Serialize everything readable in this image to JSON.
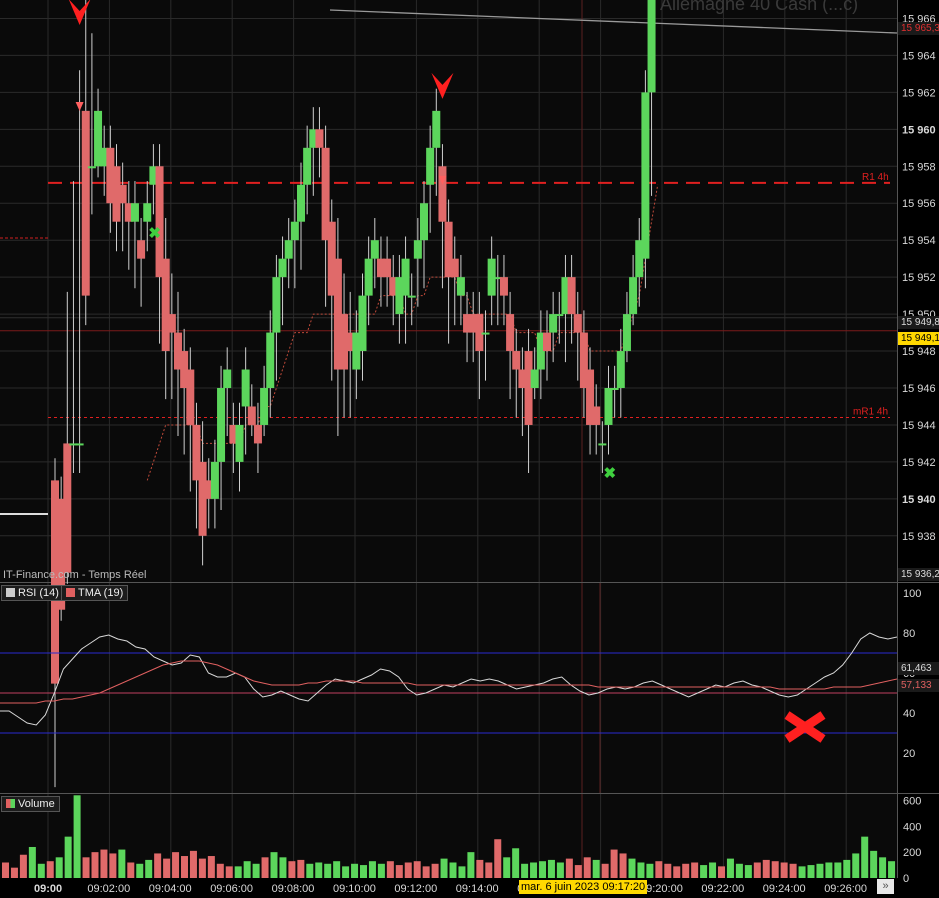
{
  "chart_data": [
    {
      "type": "candlestick",
      "title": "Allemagne 40 Cash (...c)",
      "source": "IT-Finance.com - Temps Réel",
      "ylim": [
        15935.5,
        15967
      ],
      "y_ticks": [
        "15 938",
        "15 940",
        "15 942",
        "15 944",
        "15 946",
        "15 948",
        "15 950",
        "15 952",
        "15 954",
        "15 956",
        "15 958",
        "15 960",
        "15 962",
        "15 964",
        "15 966"
      ],
      "x_ticks": [
        "09:00",
        "09:02:00",
        "09:04:00",
        "09:06:00",
        "09:08:00",
        "09:10:00",
        "09:12:00",
        "09:14:00",
        "09:16:00",
        "09:18:00",
        "09:20:00",
        "09:22:00",
        "09:24:00",
        "09:26:00"
      ],
      "crosshair_label": "mar. 6 juin 2023 09:17:20",
      "price_labels": [
        {
          "text": "15 965,3",
          "value": 15965.3,
          "color": "#e03030",
          "background": "#1a1a1a"
        },
        {
          "text": "15 949,8",
          "value": 15949.8,
          "color": "#dddddd",
          "background": "#1a1a1a"
        },
        {
          "text": "15 949,1",
          "value": 15949.1,
          "color": "#000000",
          "background": "#ffd800"
        },
        {
          "text": "15 936,2",
          "value": 15936.2,
          "color": "#dddddd",
          "background": "#1a1a1a"
        }
      ],
      "levels": [
        {
          "name": "R1 4h",
          "value": 15957.1,
          "color": "#e02020",
          "style": "dashed"
        },
        {
          "name": "mR1 4h",
          "value": 15944.4,
          "color": "#e02020",
          "style": "dotted"
        }
      ],
      "candles": [
        [
          15941,
          15941,
          15930,
          15925
        ],
        [
          15940,
          15940,
          15934,
          15935
        ],
        [
          15943,
          15950,
          15936,
          15940
        ],
        [
          15943,
          15956,
          15943,
          15942
        ],
        [
          15943,
          15962,
          15943,
          15942
        ],
        [
          15961,
          15966,
          15951,
          15950
        ],
        [
          15958,
          15964,
          15958,
          15956
        ],
        [
          15958,
          15958,
          15961,
          15959
        ],
        [
          15958,
          15958,
          15959,
          15957
        ],
        [
          15959,
          15959,
          15956,
          15955
        ],
        [
          15958,
          15958,
          15955,
          15954
        ],
        [
          15957,
          15957,
          15956,
          15954
        ],
        [
          15956,
          15956,
          15955,
          15953
        ],
        [
          15955,
          15956,
          15956,
          15952
        ],
        [
          15954,
          15954,
          15953,
          15951
        ],
        [
          15955,
          15955,
          15956,
          15954
        ],
        [
          15957,
          15957,
          15958,
          15956
        ],
        [
          15958,
          15958,
          15952,
          15949
        ],
        [
          15953,
          15954,
          15948,
          15946
        ],
        [
          15950,
          15951,
          15949,
          15946
        ],
        [
          15949,
          15950,
          15947,
          15944
        ],
        [
          15948,
          15948,
          15946,
          15943
        ],
        [
          15947,
          15947,
          15944,
          15941
        ],
        [
          15944,
          15944,
          15941,
          15939
        ],
        [
          15942,
          15943,
          15938,
          15937
        ],
        [
          15941,
          15941,
          15940,
          15939
        ],
        [
          15940,
          15940,
          15942,
          15939
        ],
        [
          15942,
          15942,
          15946,
          15940
        ],
        [
          15946,
          15946,
          15947,
          15944
        ],
        [
          15944,
          15944,
          15943,
          15942
        ],
        [
          15942,
          15942,
          15944,
          15941
        ],
        [
          15945,
          15945,
          15947,
          15943
        ],
        [
          15945,
          15945,
          15944,
          15944
        ],
        [
          15944,
          15944,
          15943,
          15942
        ],
        [
          15944,
          15944,
          15946,
          15944
        ],
        [
          15946,
          15946,
          15949,
          15945
        ],
        [
          15949,
          15949,
          15952,
          15947
        ],
        [
          15952,
          15952,
          15953,
          15950
        ],
        [
          15953,
          15953,
          15954,
          15952
        ],
        [
          15954,
          15954,
          15955,
          15952
        ],
        [
          15955,
          15955,
          15957,
          15953
        ],
        [
          15957,
          15957,
          15959,
          15956
        ],
        [
          15959,
          15959,
          15960,
          15957
        ],
        [
          15960,
          15960,
          15959,
          15958
        ],
        [
          15959,
          15959,
          15954,
          15951
        ],
        [
          15955,
          15955,
          15951,
          15947
        ],
        [
          15953,
          15954,
          15947,
          15944
        ],
        [
          15950,
          15951,
          15947,
          15945
        ],
        [
          15949,
          15950,
          15948,
          15945
        ],
        [
          15947,
          15948,
          15949,
          15946
        ],
        [
          15948,
          15948,
          15951,
          15947
        ],
        [
          15951,
          15951,
          15953,
          15950
        ],
        [
          15953,
          15954,
          15954,
          15952
        ],
        [
          15953,
          15953,
          15952,
          15951
        ],
        [
          15953,
          15953,
          15952,
          15951
        ],
        [
          15952,
          15952,
          15951,
          15950
        ],
        [
          15950,
          15950,
          15952,
          15949
        ],
        [
          15951,
          15951,
          15953,
          15949
        ],
        [
          15951,
          15951,
          15951,
          15950
        ],
        [
          15953,
          15953,
          15954,
          15951
        ],
        [
          15954,
          15954,
          15956,
          15952
        ],
        [
          15957,
          15957,
          15959,
          15955
        ],
        [
          15959,
          15959,
          15961,
          15957
        ],
        [
          15958,
          15958,
          15955,
          15952
        ],
        [
          15955,
          15955,
          15952,
          15949
        ],
        [
          15953,
          15953,
          15952,
          15950
        ],
        [
          15951,
          15951,
          15952,
          15950
        ],
        [
          15950,
          15950,
          15949,
          15948
        ],
        [
          15950,
          15950,
          15949,
          15948
        ],
        [
          15950,
          15950,
          15948,
          15946
        ],
        [
          15949,
          15949,
          15949,
          15947
        ],
        [
          15951,
          15951,
          15953,
          15950
        ],
        [
          15952,
          15952,
          15952,
          15950
        ],
        [
          15952,
          15952,
          15951,
          15950
        ],
        [
          15950,
          15950,
          15948,
          15946
        ],
        [
          15948,
          15948,
          15947,
          15945
        ],
        [
          15947,
          15947,
          15946,
          15944
        ],
        [
          15948,
          15948,
          15944,
          15942
        ],
        [
          15946,
          15946,
          15947,
          15946
        ],
        [
          15947,
          15947,
          15949,
          15946
        ],
        [
          15949,
          15949,
          15948,
          15947
        ],
        [
          15949,
          15949,
          15950,
          15948
        ],
        [
          15950,
          15950,
          15950,
          15949
        ],
        [
          15950,
          15950,
          15952,
          15948
        ],
        [
          15952,
          15952,
          15950,
          15949
        ],
        [
          15950,
          15950,
          15949,
          15947
        ],
        [
          15949,
          15949,
          15946,
          15945
        ],
        [
          15947,
          15947,
          15944,
          15943
        ],
        [
          15945,
          15945,
          15944,
          15943
        ],
        [
          15943,
          15943,
          15943,
          15942
        ],
        [
          15944,
          15944,
          15946,
          15943
        ],
        [
          15946,
          15946,
          15946,
          15945
        ],
        [
          15946,
          15946,
          15948,
          15945
        ],
        [
          15948,
          15948,
          15950,
          15948
        ],
        [
          15950,
          15950,
          15952,
          15950
        ],
        [
          15952,
          15952,
          15954,
          15951
        ],
        [
          15953,
          15953,
          15962,
          15952
        ],
        [
          15962,
          15962,
          15967,
          15957
        ]
      ],
      "signals": {
        "sell_arrows": [
          4,
          63
        ],
        "buy_crosses": [
          16,
          90
        ]
      },
      "moving_average": [
        null,
        null,
        null,
        null,
        null,
        null,
        null,
        null,
        null,
        null,
        null,
        null,
        null,
        null,
        null,
        15941,
        15942,
        15943,
        15944,
        15944,
        15944,
        15944,
        15944,
        15944,
        15943,
        15943,
        15943,
        15943,
        15943,
        15943,
        15943,
        15944,
        15944,
        15944,
        15945,
        15945,
        15946,
        15947,
        15948,
        15949,
        15949,
        15949,
        15950,
        15950,
        15950,
        15950,
        15950,
        15950,
        15950,
        15950,
        15950,
        15950,
        15950,
        15951,
        15951,
        15951,
        15951,
        15950,
        15950,
        15951,
        15951,
        15952,
        15952,
        15952,
        15952,
        15952,
        15951,
        15951,
        15950,
        15950,
        15950,
        15950,
        15950,
        15950,
        15950,
        15949,
        15949,
        15949,
        15949,
        15948,
        15948,
        15948,
        15949,
        15949,
        15949,
        15949,
        15949,
        15948,
        15948,
        15948,
        15948,
        15948,
        15948,
        15949,
        15950,
        15951,
        15953,
        15955,
        15957
      ]
    },
    {
      "type": "line",
      "legend": [
        "RSI (14)",
        "TMA (19)"
      ],
      "ylim": [
        0,
        105
      ],
      "y_ticks": [
        20,
        40,
        60,
        80,
        100
      ],
      "bands": [
        30,
        70
      ],
      "series": [
        {
          "name": "RSI (14)",
          "color": "#d9d9d9",
          "last_label": "61,463",
          "values": [
            41,
            41,
            38,
            35,
            34,
            39,
            50,
            62,
            67,
            72,
            75,
            78,
            79,
            77,
            76,
            73,
            72,
            68,
            66,
            64,
            65,
            69,
            68,
            60,
            58,
            58,
            60,
            58,
            52,
            48,
            49,
            51,
            49,
            47,
            46,
            50,
            54,
            57,
            56,
            55,
            57,
            59,
            62,
            61,
            58,
            52,
            49,
            50,
            52,
            54,
            53,
            55,
            57,
            56,
            57,
            56,
            54,
            52,
            53,
            54,
            55,
            57,
            58,
            54,
            51,
            49,
            50,
            52,
            53,
            52,
            53,
            55,
            56,
            54,
            52,
            50,
            48,
            50,
            52,
            54,
            53,
            55,
            56,
            54,
            53,
            51,
            49,
            48,
            49,
            52,
            55,
            58,
            60,
            64,
            70,
            77,
            80,
            78,
            77,
            78
          ]
        },
        {
          "name": "TMA (19)",
          "color": "#e06060",
          "last_label": "57,133",
          "values": [
            45,
            45,
            45,
            45,
            45,
            46,
            46,
            47,
            47,
            48,
            49,
            50,
            52,
            54,
            56,
            58,
            60,
            62,
            64,
            65,
            66,
            66,
            66,
            65,
            64,
            62,
            60,
            58,
            56,
            55,
            54,
            54,
            54,
            54,
            55,
            55,
            56,
            56,
            56,
            56,
            55,
            55,
            55,
            55,
            55,
            55,
            54,
            54,
            54,
            54,
            54,
            54,
            54,
            54,
            54,
            54,
            54,
            54,
            54,
            54,
            54,
            54,
            54,
            54,
            54,
            54,
            53,
            53,
            53,
            53,
            53,
            53,
            53,
            53,
            53,
            53,
            53,
            53,
            53,
            53,
            53,
            53,
            53,
            53,
            53,
            53,
            52,
            52,
            52,
            52,
            52,
            52,
            53,
            53,
            53,
            53,
            54,
            55,
            56,
            57
          ]
        }
      ],
      "markers": [
        {
          "type": "cross",
          "color": "#ff2020",
          "value": 33,
          "index": 84
        }
      ]
    },
    {
      "type": "bar",
      "legend": [
        "Volume"
      ],
      "ylim": [
        0,
        650
      ],
      "y_ticks": [
        0,
        200,
        400,
        600
      ],
      "values": [
        120,
        80,
        180,
        240,
        110,
        130,
        160,
        320,
        640,
        160,
        200,
        220,
        190,
        220,
        120,
        110,
        140,
        190,
        150,
        200,
        170,
        210,
        150,
        170,
        110,
        90,
        90,
        130,
        110,
        160,
        200,
        160,
        130,
        140,
        110,
        120,
        110,
        130,
        90,
        110,
        100,
        130,
        110,
        130,
        100,
        120,
        130,
        90,
        110,
        150,
        120,
        90,
        200,
        140,
        120,
        300,
        160,
        230,
        110,
        120,
        130,
        140,
        120,
        150,
        100,
        160,
        140,
        110,
        220,
        190,
        150,
        120,
        110,
        130,
        110,
        90,
        110,
        120,
        100,
        120,
        90,
        150,
        110,
        100,
        120,
        140,
        130,
        120,
        110,
        90,
        100,
        110,
        120,
        120,
        140,
        190,
        320,
        210,
        160,
        130
      ]
    }
  ]
}
